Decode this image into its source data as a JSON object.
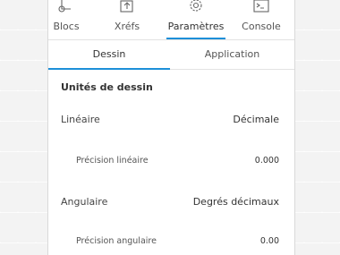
{
  "nav": {
    "items": [
      {
        "label": "Blocs",
        "icon": "blocks-icon",
        "active": false
      },
      {
        "label": "Xréfs",
        "icon": "xrefs-icon",
        "active": false
      },
      {
        "label": "Paramètres",
        "icon": "gear-icon",
        "active": true
      },
      {
        "label": "Console",
        "icon": "console-icon",
        "active": false
      }
    ]
  },
  "subtabs": [
    {
      "label": "Dessin",
      "active": true
    },
    {
      "label": "Application",
      "active": false
    }
  ],
  "section": {
    "title": "Unités de dessin",
    "rows": [
      {
        "label": "Linéaire",
        "value": "Décimale"
      },
      {
        "label": "Précision linéaire",
        "value": "0.000"
      },
      {
        "label": "Angulaire",
        "value": "Degrés décimaux"
      },
      {
        "label": "Précision angulaire",
        "value": "0.00"
      }
    ]
  },
  "colors": {
    "accent": "#1d8fd8",
    "panel": "#ffffff",
    "background": "#f3f3f3",
    "text": "#333333"
  }
}
